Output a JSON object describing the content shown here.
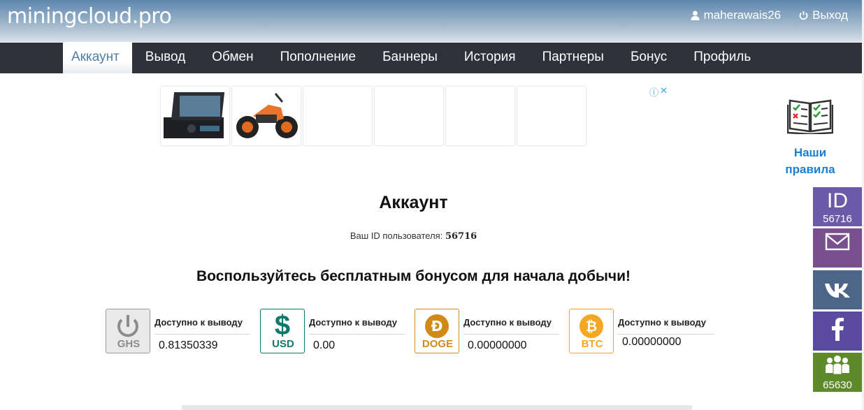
{
  "header": {
    "logo": "miningcloud.pro",
    "username": "maherawais26",
    "logout": "Выход"
  },
  "nav": {
    "items": [
      "Аккаунт",
      "Вывод",
      "Обмен",
      "Пополнение",
      "Баннеры",
      "История",
      "Партнеры",
      "Бонус",
      "Профиль"
    ],
    "active": "Аккаунт"
  },
  "ad": {
    "tile_count": 6
  },
  "sidebar": {
    "rules_line1": "Наши",
    "rules_line2": "правила",
    "id_label": "ID",
    "id_number": "56716",
    "messages_count": "",
    "partners_count": "65630"
  },
  "main": {
    "title": "Аккаунт",
    "id_label": "Ваш ID пользователя:",
    "id_value": "56716",
    "bonus_heading": "Воспользуйтесь бесплатным бонусом для начала добычи!"
  },
  "wallets": [
    {
      "code": "GHS",
      "label": "Доступно к выводу",
      "value": "0.81350339",
      "color": "#8c8c8c",
      "bg": "#e9e9e9"
    },
    {
      "code": "USD",
      "label": "Доступно к выводу",
      "value": "0.00",
      "color": "#0e7a6b",
      "bg": "#ffffff"
    },
    {
      "code": "DOGE",
      "label": "Доступно к выводу",
      "value": "0.00000000",
      "color": "#d18a18",
      "bg": "#ffffff"
    },
    {
      "code": "BTC",
      "label": "Доступно к выводу",
      "value": "0.00000000",
      "color": "#f5a623",
      "bg": "#ffffff"
    }
  ],
  "colors": {
    "nav_bg": "#2f323a",
    "accent_link": "#1a7fd4",
    "id_box": "#6a5aa8",
    "mail_box": "#7a4f8e",
    "vk_box": "#4d6587",
    "fb_box": "#5a4aa0",
    "partners_box": "#5f8a2b"
  }
}
